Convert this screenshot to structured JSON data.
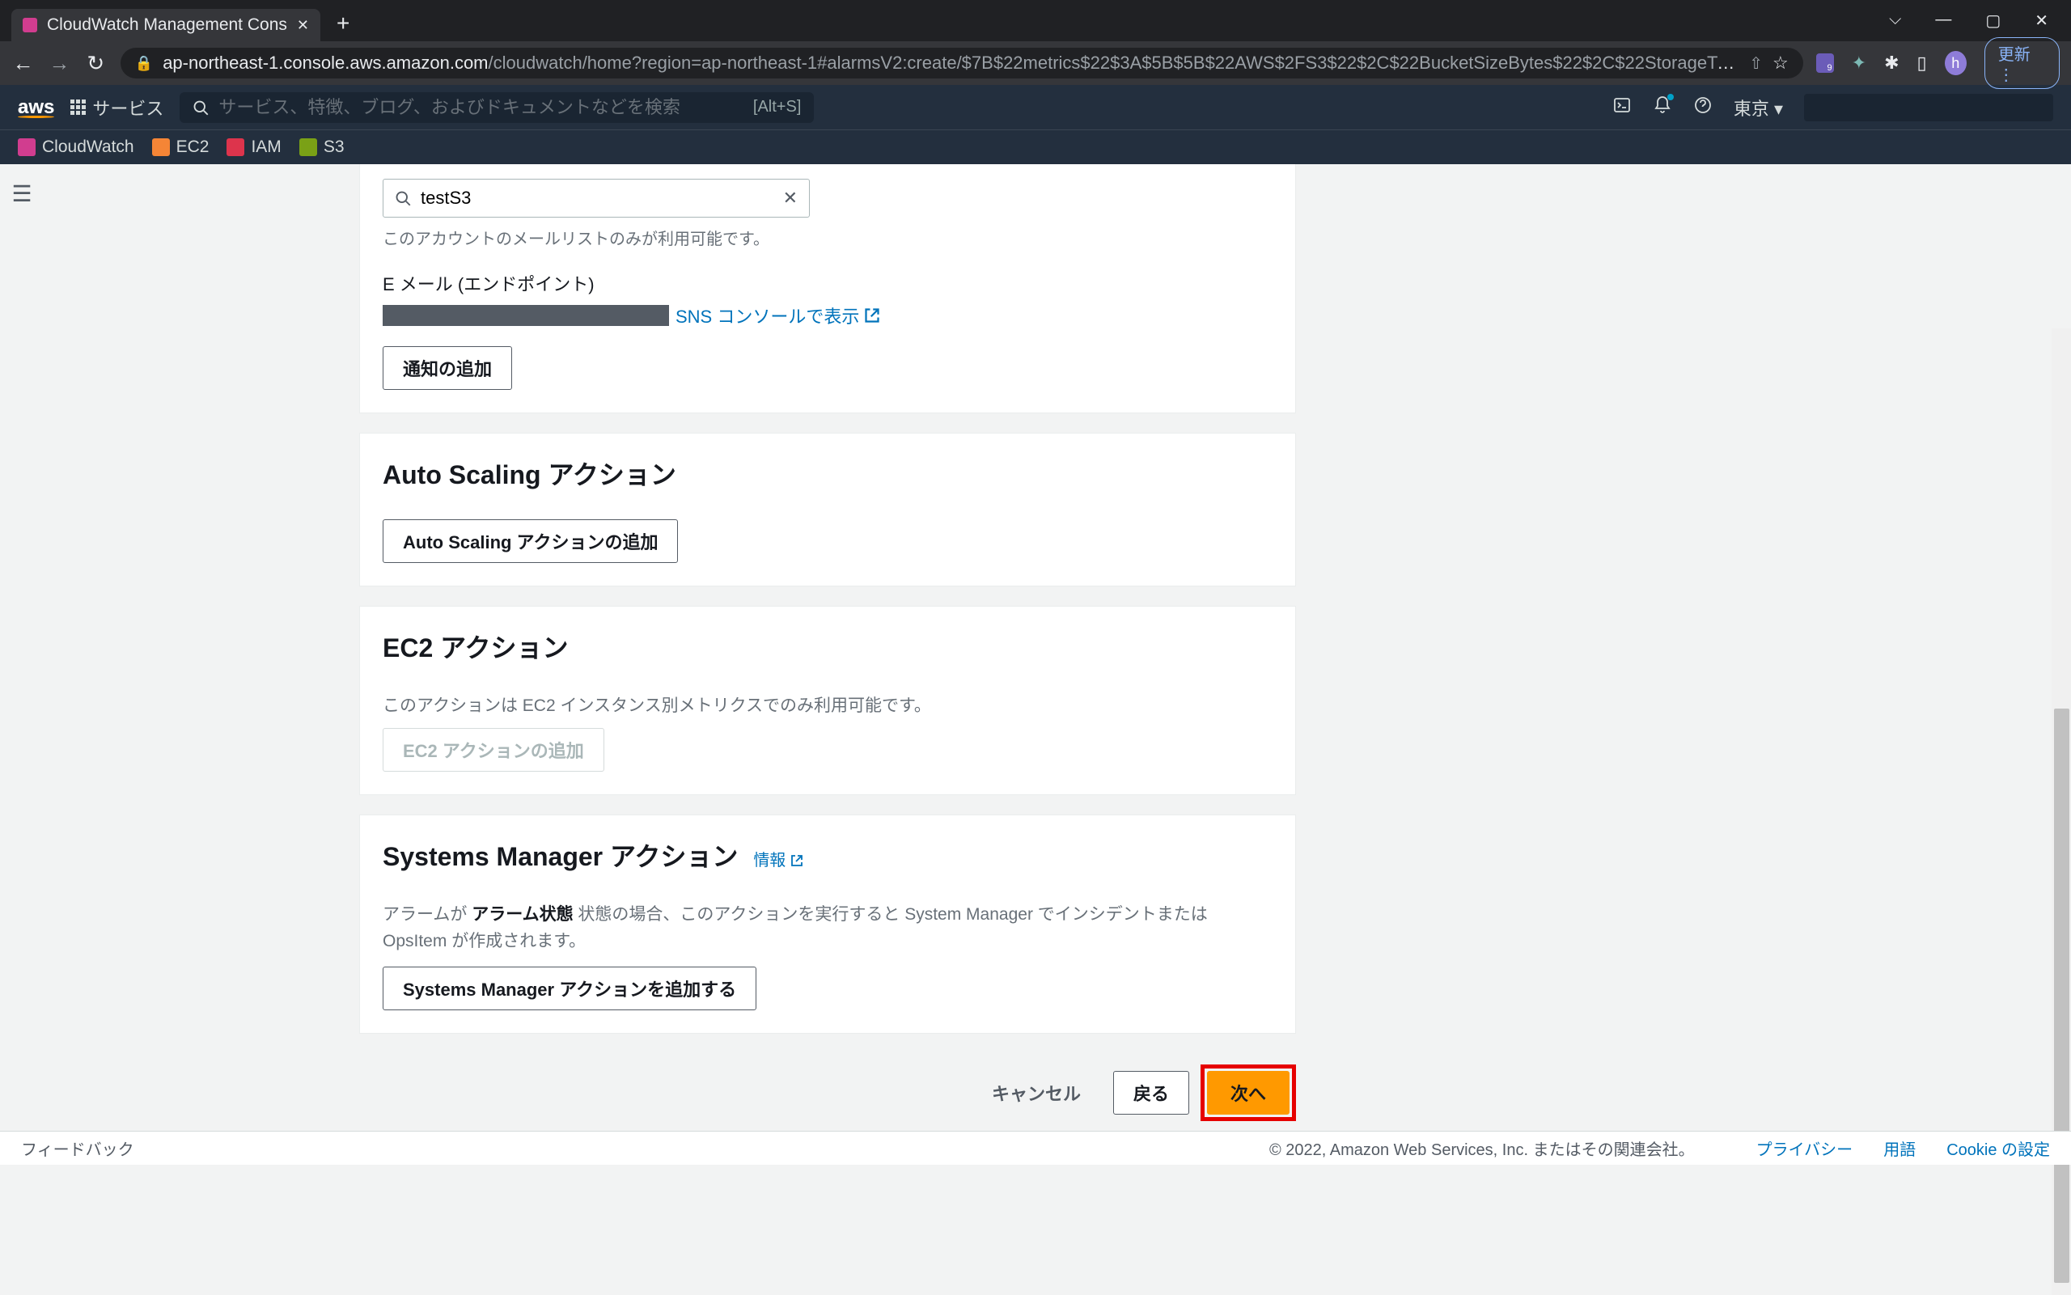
{
  "browser": {
    "tab_title": "CloudWatch Management Cons",
    "url_host": "ap-northeast-1.console.aws.amazon.com",
    "url_path": "/cloudwatch/home?region=ap-northeast-1#alarmsV2:create/$7B$22metrics$22$3A$5B$5B$22AWS$2FS3$22$2C$22BucketSizeBytes$22$2C$22StorageType$22...",
    "update_label": "更新",
    "profile_letter": "h",
    "win_chevron": "⌵"
  },
  "aws_header": {
    "services_label": "サービス",
    "search_placeholder": "サービス、特徴、ブログ、およびドキュメントなどを検索",
    "search_shortcut": "[Alt+S]",
    "region": "東京 ▾"
  },
  "service_nav": {
    "items": [
      {
        "label": "CloudWatch",
        "cls": "svc-cw"
      },
      {
        "label": "EC2",
        "cls": "svc-ec2"
      },
      {
        "label": "IAM",
        "cls": "svc-iam"
      },
      {
        "label": "S3",
        "cls": "svc-s3"
      }
    ]
  },
  "topic": {
    "search_value": "testS3",
    "help_text": "このアカウントのメールリストのみが利用可能です。",
    "endpoint_label": "E メール (エンドポイント)",
    "sns_link": "SNS コンソールで表示",
    "add_notification": "通知の追加"
  },
  "autoscaling": {
    "title": "Auto Scaling アクション",
    "add_button": "Auto Scaling アクションの追加"
  },
  "ec2": {
    "title": "EC2 アクション",
    "desc": "このアクションは EC2 インスタンス別メトリクスでのみ利用可能です。",
    "add_button": "EC2 アクションの追加"
  },
  "ssm": {
    "title": "Systems Manager アクション",
    "info": "情報",
    "desc_pre": "アラームが ",
    "desc_bold": "アラーム状態",
    "desc_post": " 状態の場合、このアクションを実行すると System Manager でインシデントまたは OpsItem が作成されます。",
    "add_button": "Systems Manager アクションを追加する"
  },
  "footer_actions": {
    "cancel": "キャンセル",
    "back": "戻る",
    "next": "次へ"
  },
  "bottom": {
    "feedback": "フィードバック",
    "copyright": "© 2022, Amazon Web Services, Inc. またはその関連会社。",
    "privacy": "プライバシー",
    "terms": "用語",
    "cookies": "Cookie の設定"
  }
}
